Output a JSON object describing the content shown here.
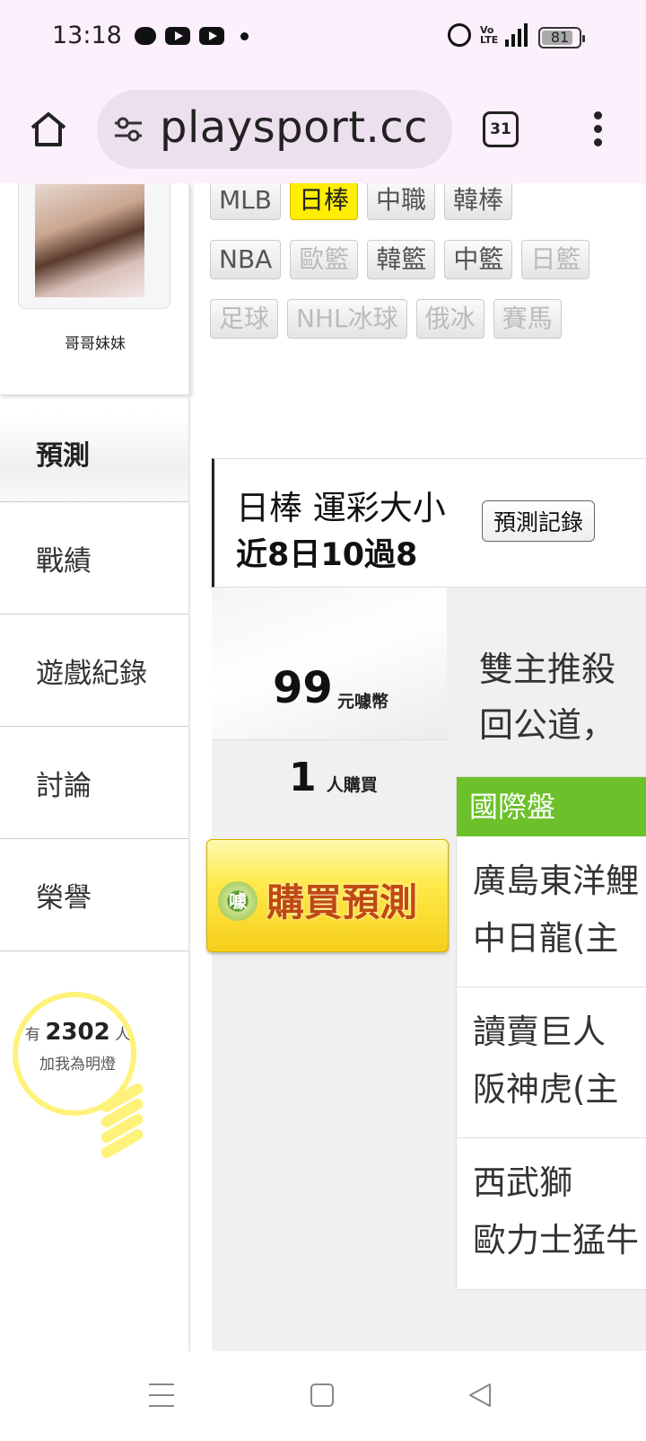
{
  "status_bar": {
    "time": "13:18",
    "volte": "Vo LTE",
    "network": "4G",
    "battery": "81"
  },
  "browser": {
    "url": "playsport.cc",
    "tab_count": "31"
  },
  "sidebar": {
    "user_name": "哥哥妹妹",
    "active_item": "預測",
    "items": [
      {
        "label": "戰績"
      },
      {
        "label": "遊戲紀錄"
      },
      {
        "label": "討論"
      },
      {
        "label": "榮譽"
      }
    ],
    "fans": {
      "prefix": "有",
      "count": "2302",
      "suffix": "人",
      "label": "加我為明燈"
    }
  },
  "league_tags": [
    [
      {
        "label": "MLB",
        "state": "normal"
      },
      {
        "label": "日棒",
        "state": "active"
      },
      {
        "label": "中職",
        "state": "normal"
      },
      {
        "label": "韓棒",
        "state": "normal"
      }
    ],
    [
      {
        "label": "NBA",
        "state": "normal"
      },
      {
        "label": "歐籃",
        "state": "disabled"
      },
      {
        "label": "韓籃",
        "state": "normal"
      },
      {
        "label": "中籃",
        "state": "normal"
      },
      {
        "label": "日籃",
        "state": "disabled"
      }
    ],
    [
      {
        "label": "足球",
        "state": "disabled"
      },
      {
        "label": "NHL冰球",
        "state": "disabled"
      },
      {
        "label": "俄冰",
        "state": "disabled"
      },
      {
        "label": "賽馬",
        "state": "disabled"
      }
    ]
  ],
  "prediction": {
    "title": "日棒 運彩大小",
    "record_summary": "近8日10過8",
    "record_button": "預測記錄",
    "price": "99",
    "price_unit": "元噱幣",
    "buyers": "1",
    "buyers_label": "人購買",
    "buy_button": "購買預測",
    "coin_glyph": "噱",
    "analysis_lines": [
      "雙主推殺",
      "回公道，"
    ],
    "market": "國際盤",
    "games": [
      {
        "away": "廣島東洋鯉",
        "home": "中日龍(主"
      },
      {
        "away": "讀賣巨人",
        "home": "阪神虎(主"
      },
      {
        "away": "西武獅",
        "home": "歐力士猛牛"
      }
    ]
  },
  "colors": {
    "active_tag": "#ffee00",
    "market_header": "#6cc12a",
    "buy_button": "#f6cf1a",
    "bulb": "#fff27a"
  }
}
